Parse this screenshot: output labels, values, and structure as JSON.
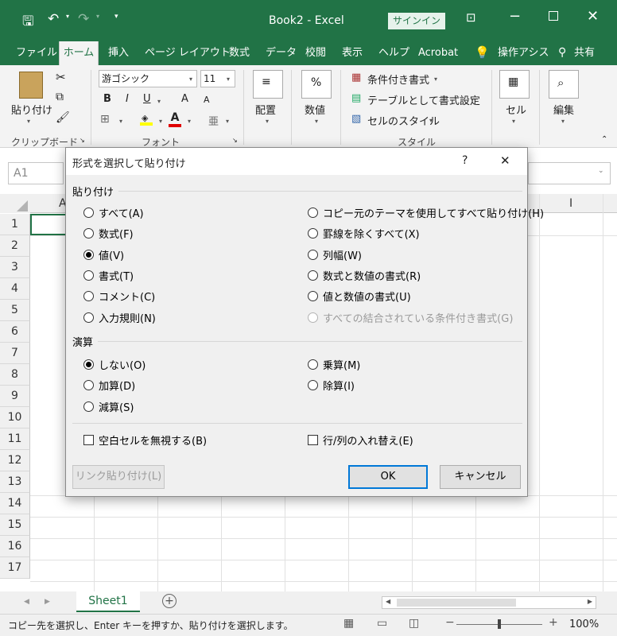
{
  "window": {
    "title": "Book2  -  Excel",
    "signin": "サインイン"
  },
  "tabs": [
    "ファイル",
    "ホーム",
    "挿入",
    "ページ レイアウト",
    "数式",
    "データ",
    "校閲",
    "表示",
    "ヘルプ",
    "Acrobat",
    "操作アシス",
    "共有"
  ],
  "ribbon": {
    "paste": "貼り付け",
    "clipboard": "クリップボード",
    "font_name": "游ゴシック",
    "font_size": "11",
    "bold": "B",
    "italic": "I",
    "underline": "U",
    "grow": "A",
    "shrink": "A",
    "font_group": "フォント",
    "align": "配置",
    "number": "数値",
    "number_icon": "%",
    "cond_format": "条件付き書式",
    "table_format": "テーブルとして書式設定",
    "cell_style": "セルのスタイル",
    "style_group": "スタイル",
    "cells": "セル",
    "edit": "編集"
  },
  "namebox": "A1",
  "columns": [
    "A",
    "I"
  ],
  "rows": [
    "1",
    "2",
    "3",
    "4",
    "5",
    "6",
    "7",
    "8",
    "9",
    "10",
    "11",
    "12",
    "13",
    "14",
    "15",
    "16",
    "17"
  ],
  "dialog": {
    "title": "形式を選択して貼り付け",
    "help": "?",
    "close": "✕",
    "paste_section": "貼り付け",
    "paste_left": [
      {
        "label": "すべて(A)",
        "checked": false
      },
      {
        "label": "数式(F)",
        "checked": false
      },
      {
        "label": "値(V)",
        "checked": true
      },
      {
        "label": "書式(T)",
        "checked": false
      },
      {
        "label": "コメント(C)",
        "checked": false
      },
      {
        "label": "入力規則(N)",
        "checked": false
      }
    ],
    "paste_right": [
      {
        "label": "コピー元のテーマを使用してすべて貼り付け(H)",
        "checked": false
      },
      {
        "label": "罫線を除くすべて(X)",
        "checked": false
      },
      {
        "label": "列幅(W)",
        "checked": false
      },
      {
        "label": "数式と数値の書式(R)",
        "checked": false
      },
      {
        "label": "値と数値の書式(U)",
        "checked": false
      },
      {
        "label": "すべての結合されている条件付き書式(G)",
        "checked": false,
        "disabled": true
      }
    ],
    "op_section": "演算",
    "op_left": [
      {
        "label": "しない(O)",
        "checked": true
      },
      {
        "label": "加算(D)",
        "checked": false
      },
      {
        "label": "減算(S)",
        "checked": false
      }
    ],
    "op_right": [
      {
        "label": "乗算(M)",
        "checked": false
      },
      {
        "label": "除算(I)",
        "checked": false
      }
    ],
    "skip_blanks": "空白セルを無視する(B)",
    "transpose": "行/列の入れ替え(E)",
    "link_button": "リンク貼り付け(L)",
    "ok": "OK",
    "cancel": "キャンセル"
  },
  "sheet_tab": "Sheet1",
  "status": {
    "message": "コピー先を選択し、Enter キーを押すか、貼り付けを選択します。",
    "zoom": "100%",
    "minus": "−",
    "plus": "+"
  },
  "colors": {
    "excel_green": "#217346",
    "accent": "#0078d7"
  }
}
